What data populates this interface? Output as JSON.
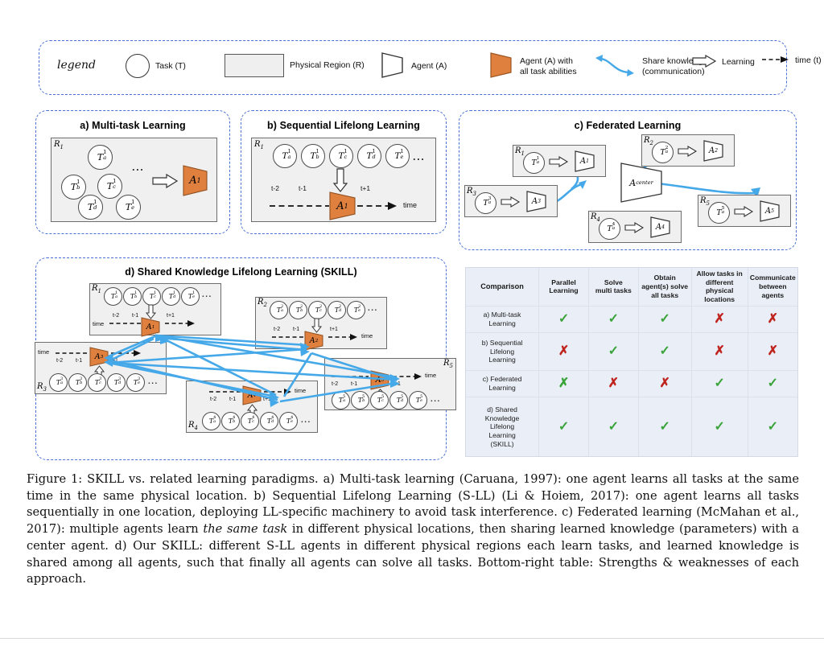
{
  "figure": {
    "number": "Figure 1:",
    "caption_p1": "Figure 1: SKILL vs. related learning paradigms. a) Multi-task learning (Caruana, 1997): one agent learns all tasks at the same time in the same physical location.  b) Sequential Lifelong Learning (S-LL) (Li & Hoiem, 2017): one agent learns all tasks sequentially in one location, deploying LL-specific machinery to avoid task interference. c) Federated learning (McMahan et al., 2017): multiple agents learn ",
    "caption_em": "the same task",
    "caption_p2": " in different physical locations, then sharing learned knowledge (parameters) with a center agent.  d) Our SKILL: different S-LL agents in different physical regions each learn tasks, and learned knowledge is shared among all agents, such that finally all agents can solve all tasks. Bottom-right table: Strengths & weaknesses of each approach."
  },
  "colors": {
    "agent_orange": "#e0803f",
    "share_blue": "#45a8e8",
    "panel_dash_blue": "#4a6fd6",
    "region_gray": "#f0f0f0",
    "check_green": "#3aa33a",
    "cross_red": "#c0241f",
    "table_bg": "#eaeff7"
  },
  "legend": {
    "title": "legend",
    "items": [
      {
        "icon": "circle-icon",
        "label": "Task (T)"
      },
      {
        "icon": "rectangle-icon",
        "label": "Physical Region (R)"
      },
      {
        "icon": "trapezoid-outline-icon",
        "label": "Agent (A)"
      },
      {
        "icon": "trapezoid-filled-icon",
        "label_line1": "Agent (A) with",
        "label_line2": "all task abilities"
      },
      {
        "icon": "s-curve-double-arrow-icon",
        "label_line1": "Share knowledge",
        "label_line2": "(communication)"
      },
      {
        "icon": "hollow-arrow-icon",
        "label": "Learning"
      },
      {
        "icon": "dashed-arrow-icon",
        "label": "time (t)"
      }
    ]
  },
  "panels": {
    "a": {
      "title": "a)  Multi-task  Learning",
      "region": "R",
      "region_sub": "1",
      "tasks": [
        "T a 1",
        "T b 1",
        "T c 1",
        "T d 1",
        "T e 1"
      ],
      "task_letters": [
        "a",
        "b",
        "c",
        "d",
        "e"
      ],
      "task_sup": "1",
      "dots": "...",
      "agent": "A",
      "agent_sub": "1",
      "arrow": "hollow-arrow-icon"
    },
    "b": {
      "title": "b) Sequential Lifelong Learning",
      "region": "R",
      "region_sub": "1",
      "task_letters": [
        "a",
        "b",
        "c",
        "d",
        "e"
      ],
      "task_sup": "1",
      "dots": "...",
      "agent": "A",
      "agent_sub": "1",
      "time_ticks": [
        "t-2",
        "t-1",
        "t+1"
      ],
      "time_label": "time"
    },
    "c": {
      "title": "c) Federated Learning",
      "center_agent": "A",
      "center_agent_sub": "center",
      "nodes": [
        {
          "region": "R",
          "region_sub": "1",
          "task_letter": "a",
          "task_sup": "1",
          "agent": "A",
          "agent_sub": "1"
        },
        {
          "region": "R",
          "region_sub": "2",
          "task_letter": "a",
          "task_sup": "2",
          "agent": "A",
          "agent_sub": "2"
        },
        {
          "region": "R",
          "region_sub": "3",
          "task_letter": "a",
          "task_sup": "3",
          "agent": "A",
          "agent_sub": "3"
        },
        {
          "region": "R",
          "region_sub": "4",
          "task_letter": "a",
          "task_sup": "4",
          "agent": "A",
          "agent_sub": "4"
        },
        {
          "region": "R",
          "region_sub": "5",
          "task_letter": "a",
          "task_sup": "5",
          "agent": "A",
          "agent_sub": "5"
        }
      ]
    },
    "d": {
      "title": "d) Shared Knowledge Lifelong Learning (SKILL)",
      "time_ticks": [
        "t-2",
        "t-1",
        "t+1"
      ],
      "time_label": "time",
      "dots": "...",
      "task_letters": [
        "a",
        "b",
        "c",
        "d",
        "e"
      ],
      "regions": [
        {
          "region": "R",
          "region_sub": "1",
          "task_sup": "1",
          "agent": "A",
          "agent_sub": "1"
        },
        {
          "region": "R",
          "region_sub": "2",
          "task_sup": "2",
          "agent": "A",
          "agent_sub": "2"
        },
        {
          "region": "R",
          "region_sub": "3",
          "task_sup": "3",
          "agent": "A",
          "agent_sub": "3"
        },
        {
          "region": "R",
          "region_sub": "4",
          "task_sup": "4",
          "agent": "A",
          "agent_sub": "4"
        },
        {
          "region": "R",
          "region_sub": "5",
          "task_sup": "5",
          "agent": "A",
          "agent_sub": "5"
        }
      ]
    }
  },
  "chart_data": {
    "type": "table",
    "title": "Comparison",
    "columns": [
      "Comparison",
      "Parallel Learning",
      "Solve multi tasks",
      "Obtain agent(s) solve all tasks",
      "Allow tasks in different physical locations",
      "Communicate between agents"
    ],
    "column_lines": [
      [
        "Comparison"
      ],
      [
        "Parallel",
        "Learning"
      ],
      [
        "Solve",
        "multi tasks"
      ],
      [
        "Obtain",
        "agent(s) solve",
        "all tasks"
      ],
      [
        "Allow  tasks in",
        "different physical",
        "locations"
      ],
      [
        "Communicate",
        "between",
        "agents"
      ]
    ],
    "rows": [
      {
        "label_lines": [
          "a) Multi-task",
          "Learning"
        ],
        "cells": [
          {
            "mark": "check",
            "color": "#3aa33a"
          },
          {
            "mark": "check",
            "color": "#3aa33a"
          },
          {
            "mark": "check",
            "color": "#3aa33a"
          },
          {
            "mark": "cross",
            "color": "#c0241f"
          },
          {
            "mark": "cross",
            "color": "#c0241f"
          }
        ]
      },
      {
        "label_lines": [
          "b) Sequential",
          "Lifelong",
          "Learning"
        ],
        "cells": [
          {
            "mark": "cross",
            "color": "#c0241f"
          },
          {
            "mark": "check",
            "color": "#3aa33a"
          },
          {
            "mark": "check",
            "color": "#3aa33a"
          },
          {
            "mark": "cross",
            "color": "#c0241f"
          },
          {
            "mark": "cross",
            "color": "#c0241f"
          }
        ]
      },
      {
        "label_lines": [
          "c) Federated",
          "Learning"
        ],
        "cells": [
          {
            "mark": "cross",
            "color": "#3aa33a"
          },
          {
            "mark": "cross",
            "color": "#c0241f"
          },
          {
            "mark": "cross",
            "color": "#c0241f"
          },
          {
            "mark": "check",
            "color": "#3aa33a"
          },
          {
            "mark": "check",
            "color": "#3aa33a"
          }
        ]
      },
      {
        "label_lines": [
          "d) Shared",
          "Knowledge",
          "Lifelong",
          "Learning",
          "(SKILL)"
        ],
        "cells": [
          {
            "mark": "check",
            "color": "#3aa33a"
          },
          {
            "mark": "check",
            "color": "#3aa33a"
          },
          {
            "mark": "check",
            "color": "#3aa33a"
          },
          {
            "mark": "check",
            "color": "#3aa33a"
          },
          {
            "mark": "check",
            "color": "#3aa33a"
          }
        ]
      }
    ]
  }
}
